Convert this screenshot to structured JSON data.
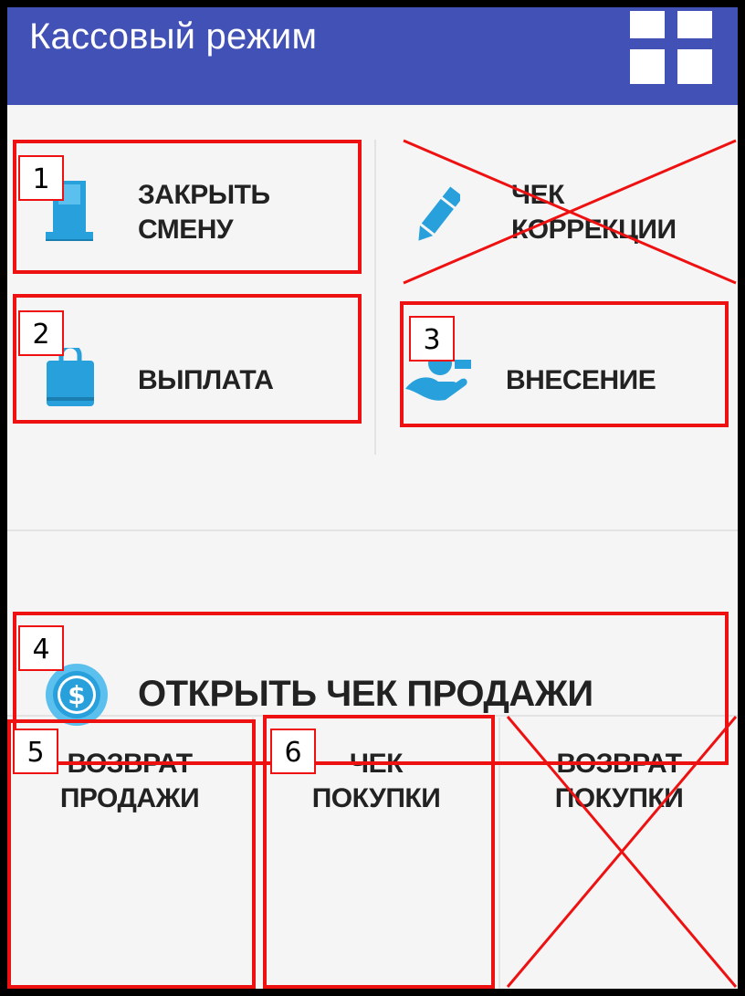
{
  "app": {
    "title": "Кассовый режим"
  },
  "header": {
    "grid_icon": "grid-icon"
  },
  "buttons": {
    "close_shift": {
      "line1": "ЗАКРЫТЬ",
      "line2": "СМЕНУ",
      "icon": "printer-icon"
    },
    "correction_check": {
      "line1": "ЧЕК",
      "line2": "КОРРЕКЦИИ",
      "icon": "pencil-icon"
    },
    "payout": {
      "label": "ВЫПЛАТА",
      "icon": "bag-icon"
    },
    "deposit": {
      "label": "ВНЕСЕНИЕ",
      "icon": "hand-coin-icon"
    },
    "open_sale": {
      "label": "ОТКРЫТЬ ЧЕК ПРОДАЖИ",
      "icon": "dollar-coin-icon"
    },
    "return_sale": {
      "line1": "ВОЗВРАТ",
      "line2": "ПРОДАЖИ"
    },
    "purchase_check": {
      "line1": "ЧЕК",
      "line2": "ПОКУПКИ"
    },
    "return_purchase": {
      "line1": "ВОЗВРАТ",
      "line2": "ПОКУПКИ"
    }
  },
  "annotations": [
    "1",
    "2",
    "3",
    "4",
    "5",
    "6"
  ],
  "colors": {
    "appbar": "#4251b5",
    "icon": "#27a0dc",
    "marker": "#ee1111",
    "background": "#f5f5f5"
  }
}
